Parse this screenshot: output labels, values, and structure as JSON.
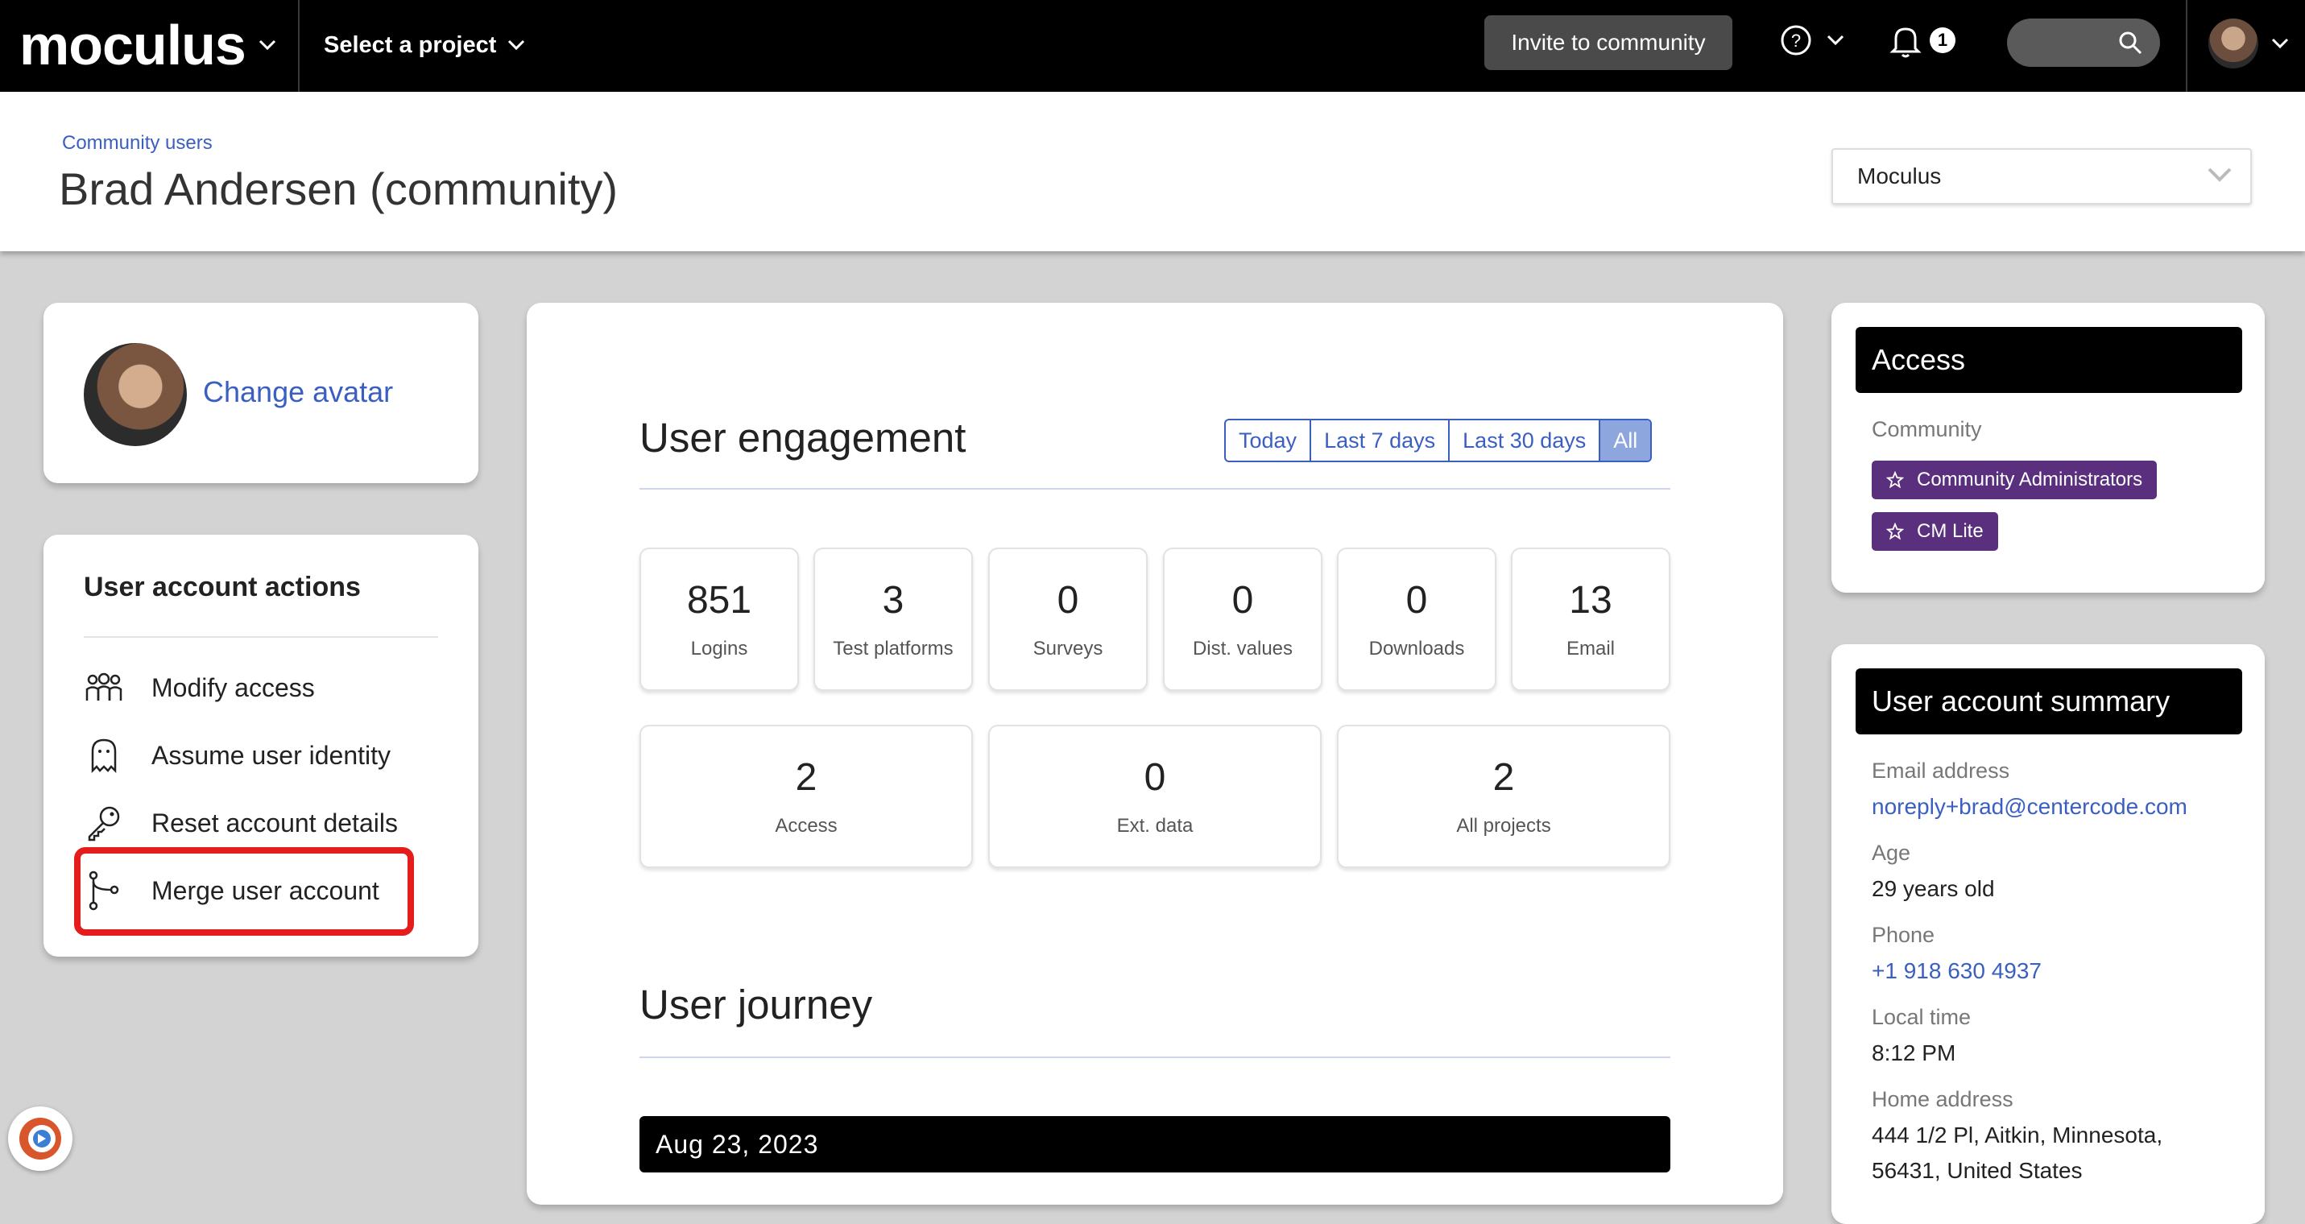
{
  "topbar": {
    "brand": "moculus",
    "project_selector": "Select a project",
    "invite_label": "Invite to community",
    "notification_count": "1"
  },
  "header": {
    "breadcrumb": "Community users",
    "title": "Brad Andersen (community)",
    "project_dropdown": "Moculus"
  },
  "avatar_card": {
    "change_label": "Change avatar"
  },
  "actions": {
    "title": "User account actions",
    "items": [
      {
        "label": "Modify access",
        "icon": "users-icon"
      },
      {
        "label": "Assume user identity",
        "icon": "ghost-icon"
      },
      {
        "label": "Reset account details",
        "icon": "key-icon"
      },
      {
        "label": "Merge user account",
        "icon": "merge-icon"
      }
    ]
  },
  "engagement": {
    "title": "User engagement",
    "ranges": [
      "Today",
      "Last 7 days",
      "Last 30 days",
      "All"
    ],
    "active_range": "All",
    "stats_row1": [
      {
        "value": "851",
        "label": "Logins"
      },
      {
        "value": "3",
        "label": "Test platforms"
      },
      {
        "value": "0",
        "label": "Surveys"
      },
      {
        "value": "0",
        "label": "Dist. values"
      },
      {
        "value": "0",
        "label": "Downloads"
      },
      {
        "value": "13",
        "label": "Email"
      }
    ],
    "stats_row2": [
      {
        "value": "2",
        "label": "Access"
      },
      {
        "value": "0",
        "label": "Ext. data"
      },
      {
        "value": "2",
        "label": "All projects"
      }
    ]
  },
  "journey": {
    "title": "User journey",
    "date": "Aug 23, 2023"
  },
  "access": {
    "title": "Access",
    "section": "Community",
    "roles": [
      "Community Administrators",
      "CM Lite"
    ],
    "role_color": "#5a2f7d"
  },
  "summary": {
    "title": "User account summary",
    "email_label": "Email address",
    "email": "noreply+brad@centercode.com",
    "age_label": "Age",
    "age": "29 years old",
    "phone_label": "Phone",
    "phone": "+1 918 630 4937",
    "time_label": "Local time",
    "time": "8:12 PM",
    "address_label": "Home address",
    "address_line1": "444 1/2 Pl, Aitkin, Minnesota,",
    "address_line2": "56431, United States"
  },
  "colors": {
    "link": "#3b5fc0",
    "highlight": "#e41c1c",
    "topbar": "#000000"
  }
}
